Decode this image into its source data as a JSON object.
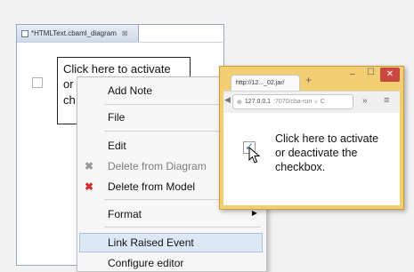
{
  "editor": {
    "tab_title": "*HTMLText.cbaml_diagram",
    "tab_close": "⊠",
    "text_lines": [
      "Click here to activate",
      "or",
      "ch"
    ]
  },
  "context_menu": {
    "items": [
      {
        "label": "Add Note",
        "enabled": true,
        "icon": "note-icon"
      },
      {
        "label": "File",
        "enabled": true
      },
      {
        "label": "Edit",
        "enabled": true
      },
      {
        "label": "Delete from Diagram",
        "enabled": false,
        "icon": "grey-x-icon"
      },
      {
        "label": "Delete from Model",
        "enabled": true,
        "icon": "red-x-icon"
      },
      {
        "label": "Format",
        "enabled": true,
        "submenu": true
      },
      {
        "label": "Link Raised Event",
        "enabled": true,
        "highlighted": true
      },
      {
        "label": "Configure editor",
        "enabled": true
      }
    ]
  },
  "browser": {
    "tab_title": "http://12..._02.jar/",
    "new_tab": "+",
    "url_host": "127.0.0.1",
    "url_rest": ":7070/cba-run",
    "text_lines": [
      "Click here to activate",
      "or deactivate the",
      "checkbox."
    ],
    "overflow": "»",
    "menu": "≡"
  },
  "colors": {
    "browser_frame": "#f4ce73",
    "close_button": "#c9483e",
    "highlight": "#dde8f6"
  }
}
